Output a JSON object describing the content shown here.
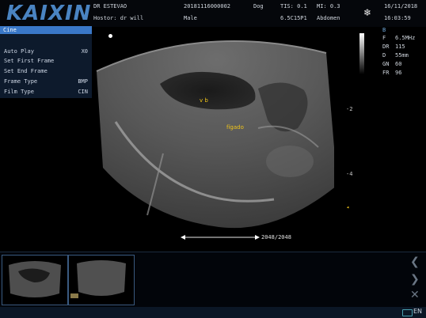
{
  "header": {
    "brand": "KAIXIN",
    "hospital": "DR ESTEVAO",
    "operator": "Hostor: dr will",
    "patient_id": "20181116000002",
    "species": "Dog",
    "sex": "Male",
    "tis": "TIS: 0.1",
    "mi": "MI: 0.3",
    "probe": "6.5C15P1",
    "preset": "Abdomen",
    "date": "16/11/2018",
    "time": "16:03:59"
  },
  "menu": {
    "title": "Cine",
    "items": [
      {
        "label": "Auto Play",
        "value": "X0"
      },
      {
        "label": "Set First Frame",
        "value": ""
      },
      {
        "label": "Set End Frame",
        "value": ""
      },
      {
        "label": "Frame Type",
        "value": "BMP"
      },
      {
        "label": "Film Type",
        "value": "CIN"
      }
    ]
  },
  "params": {
    "mode": "B",
    "rows": [
      {
        "key": "F",
        "value": "6.5MHz"
      },
      {
        "key": "DR",
        "value": "115"
      },
      {
        "key": "D",
        "value": "55mm"
      },
      {
        "key": "GN",
        "value": "60"
      },
      {
        "key": "FR",
        "value": "96"
      }
    ]
  },
  "depth_marks": [
    "-2",
    "-4"
  ],
  "annotations": [
    "v b",
    "fígado"
  ],
  "cine": {
    "frame_counter": "2048/2048"
  },
  "footer": {
    "language": "EN"
  },
  "colors": {
    "brand": "#4a84c2",
    "menu_title_bg": "#3a78c8",
    "annotation": "#f0c419"
  }
}
